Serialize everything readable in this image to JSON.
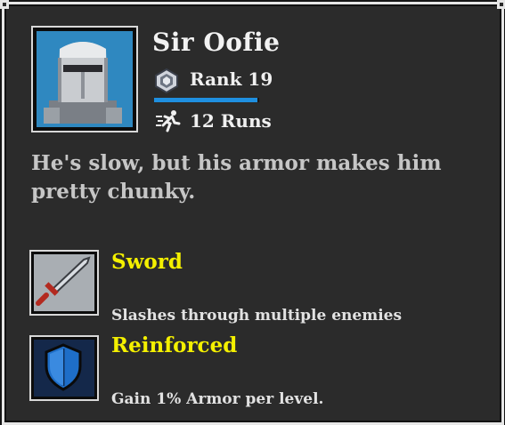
{
  "character": {
    "name": "Sir Oofie",
    "portrait_icon": "knight-helmet-icon",
    "rank_label": "Rank 19",
    "rank_icon": "rank-badge-icon",
    "rank_progress": 0.98,
    "runs_label": "12 Runs",
    "runs_icon": "running-figure-icon",
    "description": "He's slow, but his armor makes him pretty chunky."
  },
  "abilities": [
    {
      "name": "Sword",
      "description": "Slashes through multiple enemies",
      "icon": "sword-icon"
    },
    {
      "name": "Reinforced",
      "description": "Gain 1% Armor per level.",
      "icon": "shield-icon"
    }
  ],
  "colors": {
    "panel_bg": "#2b2b2b",
    "border": "#e6e6e6",
    "ability_name": "#f4f000",
    "rank_bar": "#1f8fe0",
    "description_text": "#c6c6c6"
  }
}
